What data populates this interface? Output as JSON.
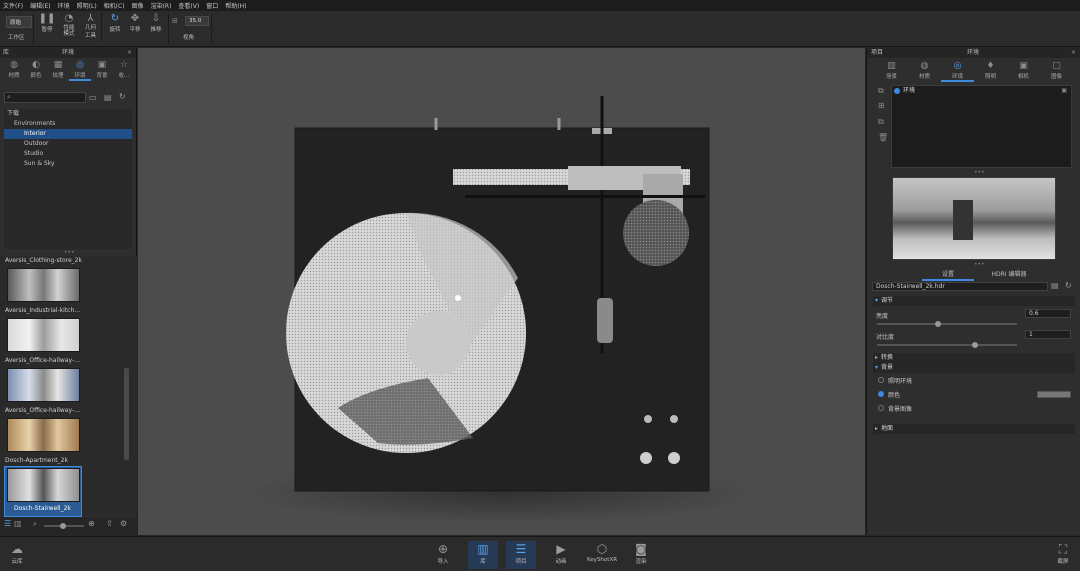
{
  "menu": [
    "文件(F)",
    "编辑(E)",
    "环境",
    "照明(L)",
    "相机(C)",
    "图像",
    "渲染(R)",
    "查看(V)",
    "窗口",
    "帮助(H)"
  ],
  "toolbar": {
    "workspace_value": "原始",
    "workspace_label": "工作区",
    "pause_label": "暂停",
    "perf_mode_label": "性能\n模式",
    "geom_tool_label": "工具",
    "geom_tool_top": "几何",
    "rotate_label": "旋转",
    "pan_label": "平移",
    "push_label": "推移",
    "fov_value": "35.0",
    "fov_label": "视角"
  },
  "left": {
    "title": "环境",
    "tabs": [
      {
        "label": "材质",
        "icon": "sphere-icon"
      },
      {
        "label": "颜色",
        "icon": "palette-icon"
      },
      {
        "label": "纹理",
        "icon": "texture-icon"
      },
      {
        "label": "环境",
        "icon": "globe-icon"
      },
      {
        "label": "背景",
        "icon": "image-icon"
      },
      {
        "label": "收…",
        "icon": "star-icon"
      }
    ],
    "tree": {
      "root": "下载",
      "group": "Environments",
      "items": [
        "Interior",
        "Outdoor",
        "Studio",
        "Sun & Sky"
      ]
    },
    "thumbs": [
      "Aversis_Clothing-store_2k",
      "Aversis_Industrial-kitch…",
      "Aversis_Office-hallway-…",
      "Aversis_Office-hallway-…",
      "Dosch-Apartment_2k",
      "Dosch-Stairwell_2k"
    ]
  },
  "right": {
    "project_title": "项目",
    "title": "环境",
    "tabs": [
      {
        "label": "场景",
        "icon": "scene-icon"
      },
      {
        "label": "材质",
        "icon": "sphere-icon"
      },
      {
        "label": "环境",
        "icon": "globe-icon"
      },
      {
        "label": "照明",
        "icon": "bulb-icon"
      },
      {
        "label": "相机",
        "icon": "camera-icon"
      },
      {
        "label": "图像",
        "icon": "frame-icon"
      }
    ],
    "env_item": "环境",
    "subtabs": [
      "设置",
      "HDRI 编辑器"
    ],
    "env_name": "Dosch-Stairwell_2k.hdr",
    "adjust_header": "调节",
    "brightness_label": "亮度",
    "brightness_value": "0.6",
    "contrast_label": "对比度",
    "contrast_value": "1",
    "transform_header": "转换",
    "background_header": "背景",
    "bg_options": [
      "照明环境",
      "颜色",
      "背景图像"
    ],
    "ground_header": "地面"
  },
  "bottom": [
    {
      "label": "云库",
      "icon": "cloud-icon"
    },
    {
      "label": "导入",
      "icon": "import-icon"
    },
    {
      "label": "库",
      "icon": "book-icon"
    },
    {
      "label": "项目",
      "icon": "list-icon"
    },
    {
      "label": "动画",
      "icon": "play-icon"
    },
    {
      "label": "KeyShotXR",
      "icon": "cube-icon"
    },
    {
      "label": "渲染",
      "icon": "render-icon"
    },
    {
      "label": "截屏",
      "icon": "screenshot-icon"
    }
  ],
  "colors": {
    "accent": "#3d8ae0",
    "viewport": "#4c4c4c",
    "panel": "#2e2e2e"
  }
}
